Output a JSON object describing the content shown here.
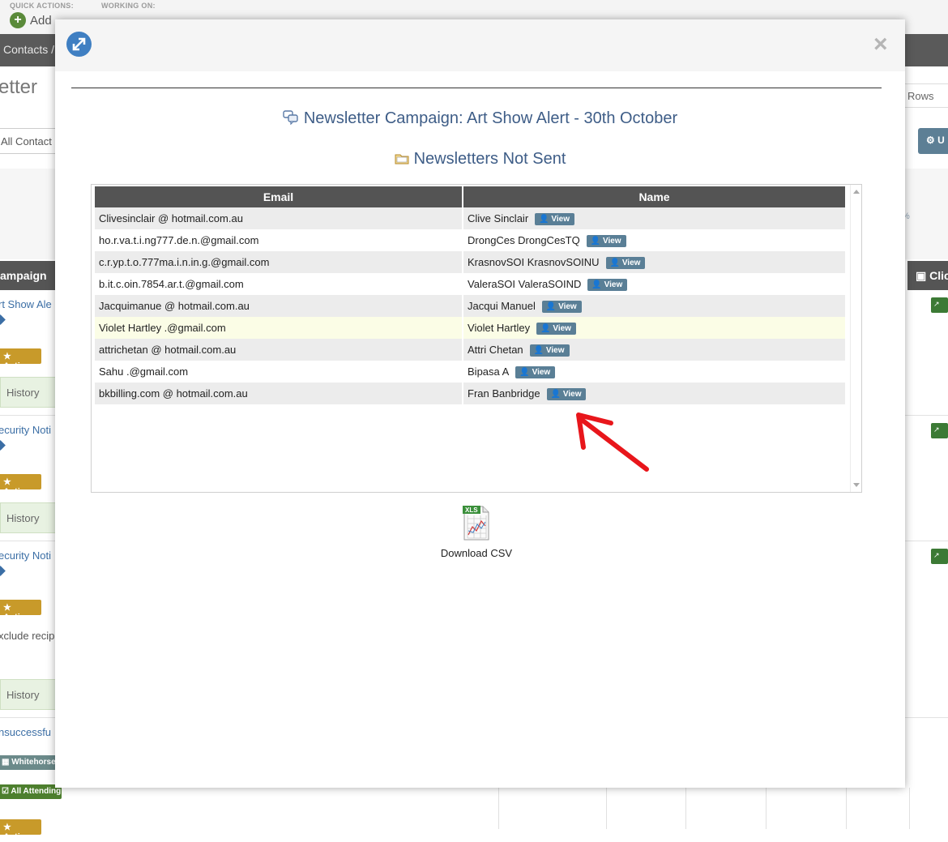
{
  "background": {
    "quick_actions_label": "QUICK ACTIONS:",
    "working_on_label": "WORKING ON:",
    "add_label": "Add",
    "breadcrumb": "Contacts /",
    "page_title": "etter",
    "rows_label": "Rows",
    "filter_value": "All Contact",
    "tool_label": "U",
    "percent": "%",
    "campaign_header": "ampaign",
    "click_header": "Click",
    "rows": [
      {
        "link": "rt Show Ale",
        "actions": "Actions",
        "history": "History"
      },
      {
        "link": "ecurity Noti",
        "actions": "Actions",
        "history": "History"
      },
      {
        "link": "ecurity Noti",
        "actions": "Actions",
        "extra": "xclude recip",
        "history": "History"
      },
      {
        "link": "nsuccessfu",
        "tag1": "Whitehorse",
        "tag2": "All Attending",
        "actions": "Actions"
      }
    ]
  },
  "modal": {
    "campaign_title": "Newsletter Campaign: Art Show Alert - 30th October",
    "subtitle": "Newsletters Not Sent",
    "columns": {
      "email": "Email",
      "name": "Name"
    },
    "view_label": "View",
    "rows": [
      {
        "email": "Clivesinclair @ hotmail.com.au",
        "name": "Clive Sinclair"
      },
      {
        "email": "ho.r.va.t.i.ng777.de.n.@gmail.com",
        "name": "DrongCes DrongCesTQ"
      },
      {
        "email": "c.r.yp.t.o.777ma.i.n.in.g.@gmail.com",
        "name": "KrasnovSOI KrasnovSOINU"
      },
      {
        "email": "b.it.c.oin.7854.ar.t.@gmail.com",
        "name": "ValeraSOI ValeraSOIND"
      },
      {
        "email": "Jacquimanuе    @ hotmail.com.au",
        "name": "Jacqui Manuel"
      },
      {
        "email": "Violet Hartley .@gmail.com",
        "name": "Violet Hartley"
      },
      {
        "email": "attrichetan  @ hotmail.com.au",
        "name": "Attri Chetan"
      },
      {
        "email": "Sahu .@gmail.com",
        "name": "Bipasa A"
      },
      {
        "email": "bkbilling.com  @ hotmail.com.au",
        "name": "Fran Banbridge"
      }
    ],
    "download_label": "Download CSV",
    "file_badge": "XLS",
    "colors": {
      "title": "#3e5d87",
      "header": "#545454",
      "view_button": "#5a7f96",
      "annotation_arrow": "#e8161b"
    }
  }
}
